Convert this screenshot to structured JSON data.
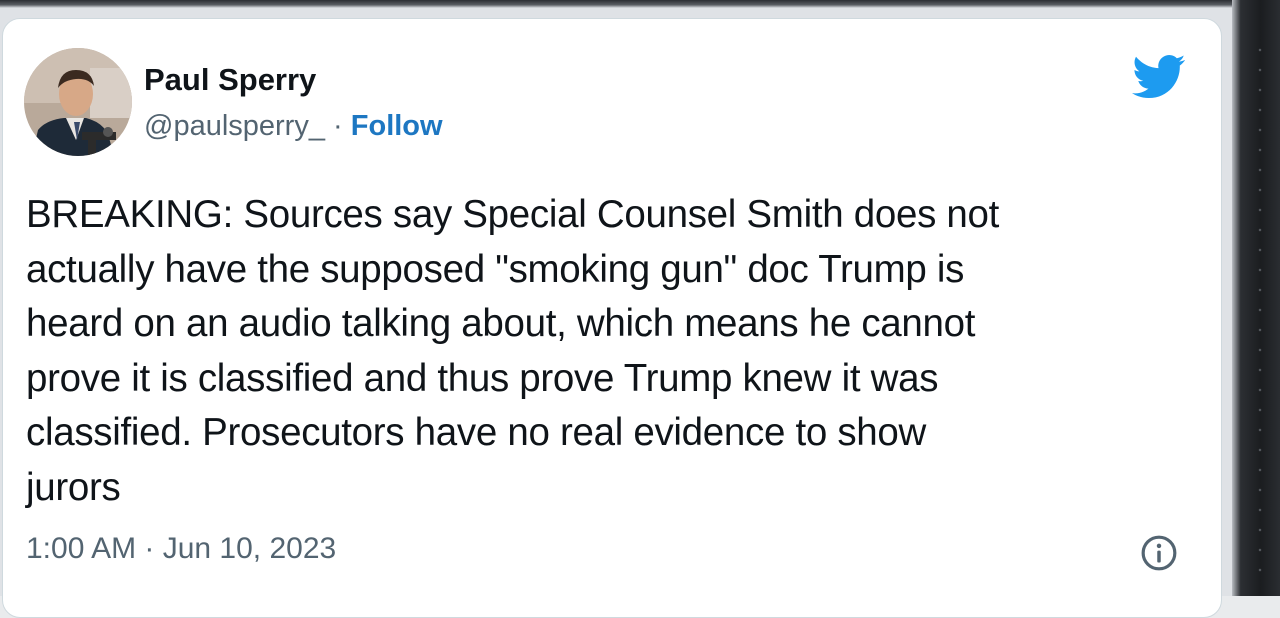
{
  "tweet": {
    "author_name": "Paul Sperry",
    "handle": "@paulsperry_",
    "separator": "·",
    "follow_label": "Follow",
    "text": "BREAKING: Sources say Special Counsel Smith does not\nactually have the supposed \"smoking gun\" doc Trump is\nheard on an audio talking about, which means he cannot\nprove it is classified and thus prove Trump knew it was\nclassified. Prosecutors have no real evidence to show\njurors",
    "timestamp": "1:00 AM · Jun 10, 2023",
    "brand_icon": "twitter-bird-icon",
    "info_icon": "info-icon"
  },
  "colors": {
    "brand": "#1d9bf0",
    "link": "#1d77c2",
    "text_primary": "#0f1419",
    "text_secondary": "#536471",
    "card_border": "#cfd9de"
  }
}
